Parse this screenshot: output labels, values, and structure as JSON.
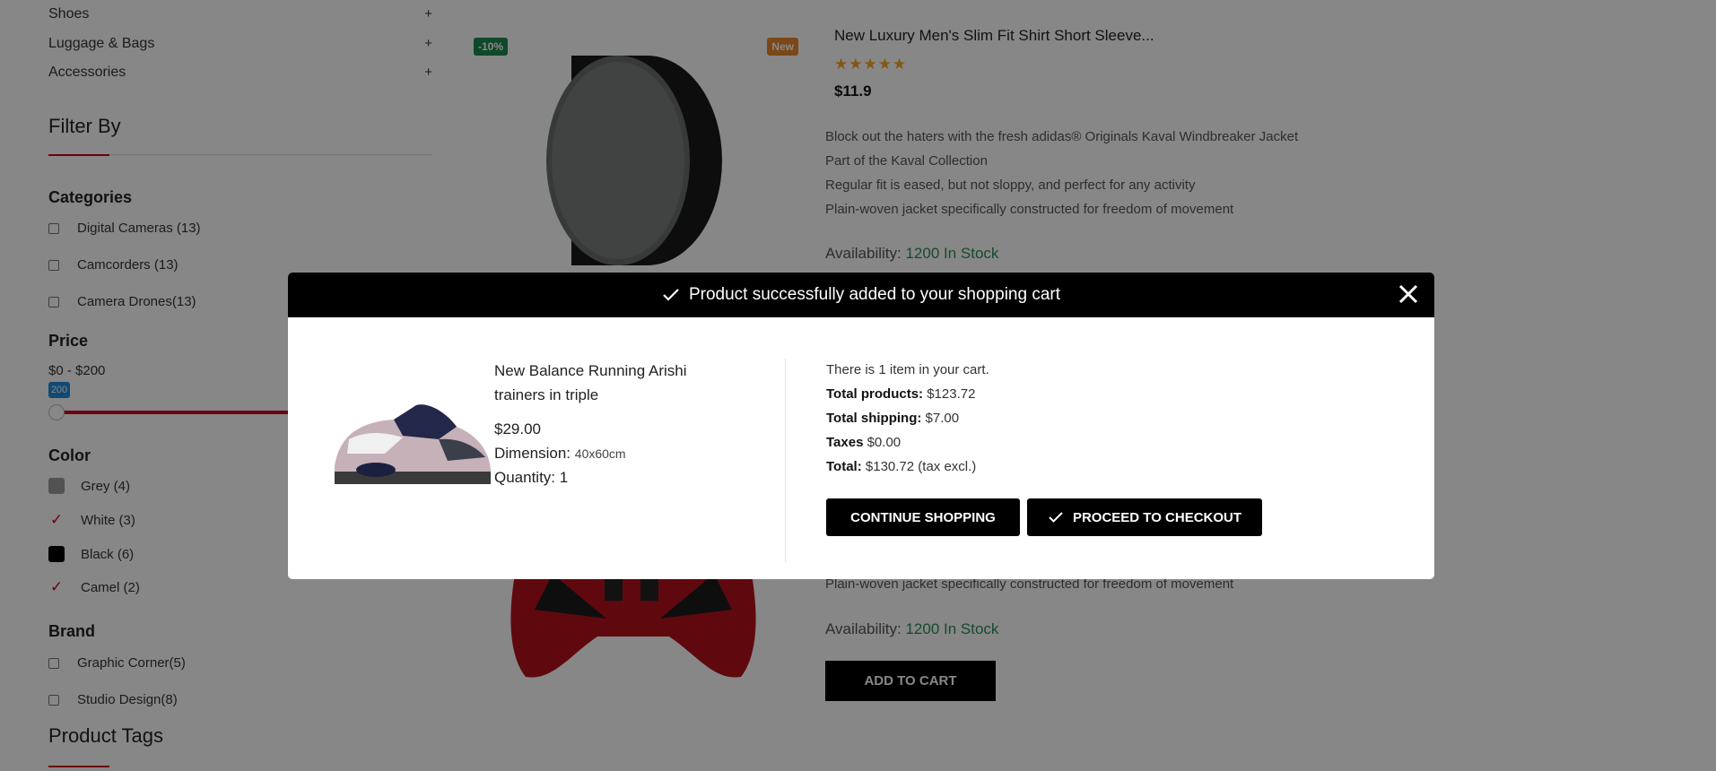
{
  "sidebar": {
    "category_links": [
      {
        "label": "Shoes",
        "toggle": "+"
      },
      {
        "label": "Luggage & Bags",
        "toggle": "+"
      },
      {
        "label": "Accessories",
        "toggle": "+"
      }
    ],
    "filter_title": "Filter By",
    "categories": {
      "title": "Categories",
      "items": [
        "Digital Cameras (13)",
        "Camcorders (13)",
        "Camera Drones(13)"
      ]
    },
    "price": {
      "title": "Price",
      "range": "$0 - $200",
      "tooltip": "200",
      "max_value": 200
    },
    "color": {
      "title": "Color",
      "items": [
        {
          "label": "Grey (4)",
          "swatch": "#9b9b9b",
          "checked": false
        },
        {
          "label": "White (3)",
          "swatch": "#ffffff",
          "checked": true
        },
        {
          "label": "Black (6)",
          "swatch": "#000000",
          "checked": false
        },
        {
          "label": "Camel (2)",
          "swatch": "#c19a6b",
          "checked": true
        }
      ]
    },
    "brand": {
      "title": "Brand",
      "items": [
        "Graphic Corner(5)",
        "Studio Design(8)"
      ]
    },
    "tags_title": "Product Tags"
  },
  "product": {
    "discount_badge": "-10%",
    "new_badge": "New",
    "title": "New Luxury Men's Slim Fit Shirt Short Sleeve...",
    "rating": 5,
    "stars": "★★★★★",
    "price": "$11.9",
    "description": [
      "Block out the haters with the fresh adidas® Originals Kaval Windbreaker Jacket",
      "Part of the Kaval Collection",
      "Regular fit is eased, but not sloppy, and perfect for any activity",
      "Plain-woven jacket specifically constructed for freedom of movement"
    ],
    "availability_label": "Availability:",
    "availability_value": "1200 In Stock"
  },
  "product2": {
    "description_last": "Plain-woven jacket specifically constructed for freedom of movement",
    "availability_label": "Availability:",
    "availability_value": "1200 In Stock",
    "add_to_cart": "ADD TO CART"
  },
  "modal": {
    "header": "Product successfully added to your shopping cart",
    "item": {
      "name": "New Balance Running Arishi trainers in triple",
      "price": "$29.00",
      "dimension_label": "Dimension:",
      "dimension_value": "40x60cm",
      "quantity_label": "Quantity:",
      "quantity_value": "1"
    },
    "summary": {
      "items_text": "There is 1 item in your cart.",
      "total_products_label": "Total products:",
      "total_products_value": "$123.72",
      "total_shipping_label": "Total shipping:",
      "total_shipping_value": "$7.00",
      "taxes_label": "Taxes",
      "taxes_value": "$0.00",
      "total_label": "Total:",
      "total_value": "$130.72 (tax excl.)"
    },
    "continue_label": "CONTINUE SHOPPING",
    "checkout_label": "PROCEED TO CHECKOUT"
  },
  "colors": {
    "accent": "#d0021b",
    "in_stock": "#2e8b57",
    "discount_badge": "#1e8a4f",
    "new_badge": "#e8862a",
    "star": "#f5a623"
  }
}
